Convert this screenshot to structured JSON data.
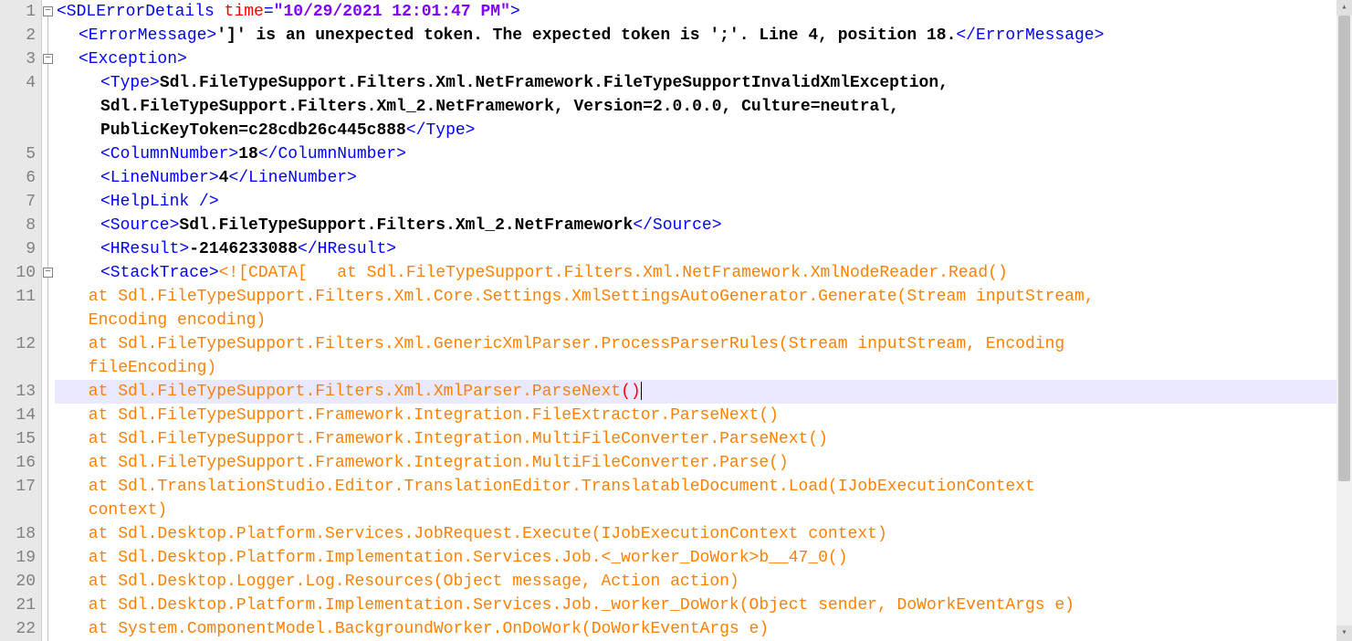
{
  "lineNumbers": [
    "1",
    "2",
    "3",
    "4",
    "",
    "",
    "5",
    "6",
    "7",
    "8",
    "9",
    "10",
    "11",
    "",
    "12",
    "",
    "13",
    "14",
    "15",
    "16",
    "17",
    "",
    "18",
    "19",
    "20",
    "21",
    "22"
  ],
  "fold": [
    {
      "row": 0,
      "type": "minus"
    },
    {
      "row": 2,
      "type": "minus"
    },
    {
      "row": 11,
      "type": "minus"
    }
  ],
  "rows": [
    {
      "row": 0,
      "ind": 0,
      "segs": [
        {
          "c": "tag",
          "t": "<SDLErrorDetails"
        },
        {
          "c": "txt",
          "t": " "
        },
        {
          "c": "attr",
          "t": "time"
        },
        {
          "c": "tag",
          "t": "="
        },
        {
          "c": "val",
          "t": "\"10/29/2021 12:01:47 PM\""
        },
        {
          "c": "tag",
          "t": ">"
        }
      ]
    },
    {
      "row": 1,
      "ind": 1,
      "segs": [
        {
          "c": "tag",
          "t": "<ErrorMessage>"
        },
        {
          "c": "txt",
          "t": "']' is an unexpected token. The expected token is ';'. Line 4, position 18."
        },
        {
          "c": "tag",
          "t": "</ErrorMessage>"
        }
      ]
    },
    {
      "row": 2,
      "ind": 1,
      "segs": [
        {
          "c": "tag",
          "t": "<Exception>"
        }
      ]
    },
    {
      "row": 3,
      "ind": 2,
      "segs": [
        {
          "c": "tag",
          "t": "<Type>"
        },
        {
          "c": "txt",
          "t": "Sdl.FileTypeSupport.Filters.Xml.NetFramework.FileTypeSupportInvalidXmlException, "
        }
      ]
    },
    {
      "row": 4,
      "ind": 2,
      "segs": [
        {
          "c": "txt",
          "t": "Sdl.FileTypeSupport.Filters.Xml_2.NetFramework, Version=2.0.0.0, Culture=neutral, "
        }
      ]
    },
    {
      "row": 5,
      "ind": 2,
      "segs": [
        {
          "c": "txt",
          "t": "PublicKeyToken=c28cdb26c445c888"
        },
        {
          "c": "tag",
          "t": "</Type>"
        }
      ]
    },
    {
      "row": 6,
      "ind": 2,
      "segs": [
        {
          "c": "tag",
          "t": "<ColumnNumber>"
        },
        {
          "c": "txt",
          "t": "18"
        },
        {
          "c": "tag",
          "t": "</ColumnNumber>"
        }
      ]
    },
    {
      "row": 7,
      "ind": 2,
      "segs": [
        {
          "c": "tag",
          "t": "<LineNumber>"
        },
        {
          "c": "txt",
          "t": "4"
        },
        {
          "c": "tag",
          "t": "</LineNumber>"
        }
      ]
    },
    {
      "row": 8,
      "ind": 2,
      "segs": [
        {
          "c": "tag",
          "t": "<HelpLink />"
        }
      ]
    },
    {
      "row": 9,
      "ind": 2,
      "segs": [
        {
          "c": "tag",
          "t": "<Source>"
        },
        {
          "c": "txt",
          "t": "Sdl.FileTypeSupport.Filters.Xml_2.NetFramework"
        },
        {
          "c": "tag",
          "t": "</Source>"
        }
      ]
    },
    {
      "row": 10,
      "ind": 2,
      "segs": [
        {
          "c": "tag",
          "t": "<HResult>"
        },
        {
          "c": "txt",
          "t": "-2146233088"
        },
        {
          "c": "tag",
          "t": "</HResult>"
        }
      ]
    },
    {
      "row": 11,
      "ind": 2,
      "segs": [
        {
          "c": "tag",
          "t": "<StackTrace>"
        },
        {
          "c": "cdata",
          "t": "<![CDATA[   at Sdl.FileTypeSupport.Filters.Xml.NetFramework.XmlNodeReader.Read()"
        }
      ]
    },
    {
      "row": 12,
      "ind": 1,
      "segs": [
        {
          "c": "cdata",
          "t": " at Sdl.FileTypeSupport.Filters.Xml.Core.Settings.XmlSettingsAutoGenerator.Generate(Stream inputStream, "
        }
      ]
    },
    {
      "row": 13,
      "ind": 1,
      "segs": [
        {
          "c": "cdata",
          "t": " Encoding encoding)"
        }
      ]
    },
    {
      "row": 14,
      "ind": 1,
      "segs": [
        {
          "c": "cdata",
          "t": " at Sdl.FileTypeSupport.Filters.Xml.GenericXmlParser.ProcessParserRules(Stream inputStream, Encoding "
        }
      ]
    },
    {
      "row": 15,
      "ind": 1,
      "segs": [
        {
          "c": "cdata",
          "t": " fileEncoding)"
        }
      ]
    },
    {
      "row": 16,
      "ind": 1,
      "hl": true,
      "segs": [
        {
          "c": "cdata",
          "t": " at Sdl.FileTypeSupport.Filters.Xml.XmlParser.ParseNext"
        },
        {
          "c": "paren",
          "t": "()"
        }
      ],
      "cursor": true
    },
    {
      "row": 17,
      "ind": 1,
      "segs": [
        {
          "c": "cdata",
          "t": " at Sdl.FileTypeSupport.Framework.Integration.FileExtractor.ParseNext()"
        }
      ]
    },
    {
      "row": 18,
      "ind": 1,
      "segs": [
        {
          "c": "cdata",
          "t": " at Sdl.FileTypeSupport.Framework.Integration.MultiFileConverter.ParseNext()"
        }
      ]
    },
    {
      "row": 19,
      "ind": 1,
      "segs": [
        {
          "c": "cdata",
          "t": " at Sdl.FileTypeSupport.Framework.Integration.MultiFileConverter.Parse()"
        }
      ]
    },
    {
      "row": 20,
      "ind": 1,
      "segs": [
        {
          "c": "cdata",
          "t": " at Sdl.TranslationStudio.Editor.TranslationEditor.TranslatableDocument.Load(IJobExecutionContext "
        }
      ]
    },
    {
      "row": 21,
      "ind": 1,
      "segs": [
        {
          "c": "cdata",
          "t": " context)"
        }
      ]
    },
    {
      "row": 22,
      "ind": 1,
      "segs": [
        {
          "c": "cdata",
          "t": " at Sdl.Desktop.Platform.Services.JobRequest.Execute(IJobExecutionContext context)"
        }
      ]
    },
    {
      "row": 23,
      "ind": 1,
      "segs": [
        {
          "c": "cdata",
          "t": " at Sdl.Desktop.Platform.Implementation.Services.Job.<_worker_DoWork>b__47_0()"
        }
      ]
    },
    {
      "row": 24,
      "ind": 1,
      "segs": [
        {
          "c": "cdata",
          "t": " at Sdl.Desktop.Logger.Log.Resources(Object message, Action action)"
        }
      ]
    },
    {
      "row": 25,
      "ind": 1,
      "segs": [
        {
          "c": "cdata",
          "t": " at Sdl.Desktop.Platform.Implementation.Services.Job._worker_DoWork(Object sender, DoWorkEventArgs e)"
        }
      ]
    },
    {
      "row": 26,
      "ind": 1,
      "segs": [
        {
          "c": "cdata",
          "t": " at System.ComponentModel.BackgroundWorker.OnDoWork(DoWorkEventArgs e)"
        }
      ]
    }
  ],
  "scrollbar": {
    "thumbTop": 17,
    "thumbHeight": 510
  }
}
